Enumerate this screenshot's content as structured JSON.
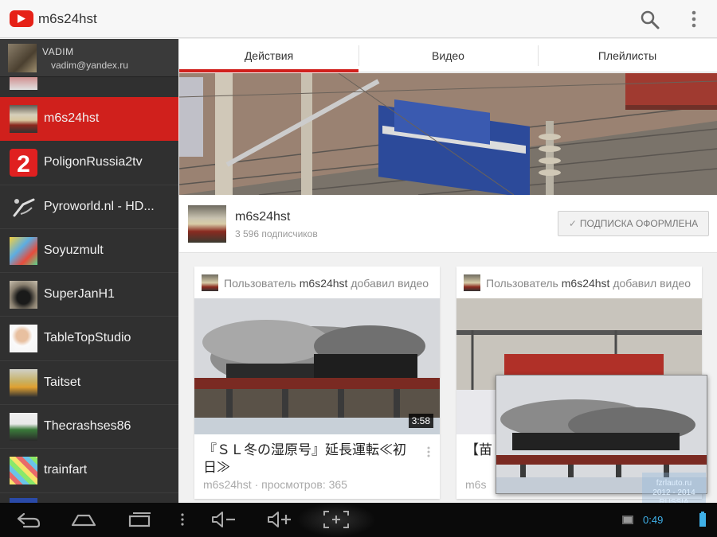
{
  "app": {
    "title": "m6s24hst"
  },
  "account": {
    "name": "VADIM",
    "email": "vadim@yandex.ru"
  },
  "sidebar": {
    "items": [
      {
        "label": "m6s24hst",
        "active": true,
        "icon": "train-thumb"
      },
      {
        "label": "PoligonRussia2tv",
        "active": false,
        "icon": "number-2-logo"
      },
      {
        "label": "Pyroworld.nl - HD...",
        "active": false,
        "icon": "firework-logo"
      },
      {
        "label": "Soyuzmult",
        "active": false,
        "icon": "cartoon-logo"
      },
      {
        "label": "SuperJanH1",
        "active": false,
        "icon": "locomotive-thumb"
      },
      {
        "label": "TableTopStudio",
        "active": false,
        "icon": "person-thumb"
      },
      {
        "label": "Taitset",
        "active": false,
        "icon": "train-thumb"
      },
      {
        "label": "Thecrashses86",
        "active": false,
        "icon": "train-thumb"
      },
      {
        "label": "trainfart",
        "active": false,
        "icon": "colorful-logo"
      }
    ]
  },
  "tabs": [
    {
      "label": "Действия",
      "selected": true
    },
    {
      "label": "Видео",
      "selected": false
    },
    {
      "label": "Плейлисты",
      "selected": false
    }
  ],
  "channel": {
    "name": "m6s24hst",
    "subscribers": "3 596 подписчиков",
    "subscribe_label": "ПОДПИСКА ОФОРМЛЕНА"
  },
  "feed": [
    {
      "action_prefix": "Пользователь",
      "user": "m6s24hst",
      "action_suffix": "добавил видео",
      "title": "『ＳＬ冬の湿原号』延長運転≪初日≫",
      "meta": "m6s24hst · просмотров: 365",
      "duration": "3:58"
    },
    {
      "action_prefix": "Пользователь",
      "user": "m6s24hst",
      "action_suffix": "добавил видео",
      "title": "【苗",
      "meta": "m6s"
    }
  ],
  "status": {
    "clock": "0:49"
  },
  "watermark": {
    "line1": "fzrlauto.ru",
    "line2": "2012 - 2014",
    "line3": "RUSSIA"
  },
  "colors": {
    "accent": "#d0201c",
    "sidebar_bg": "#303030",
    "youtube_red": "#e62117",
    "clock": "#3fb0e8"
  }
}
